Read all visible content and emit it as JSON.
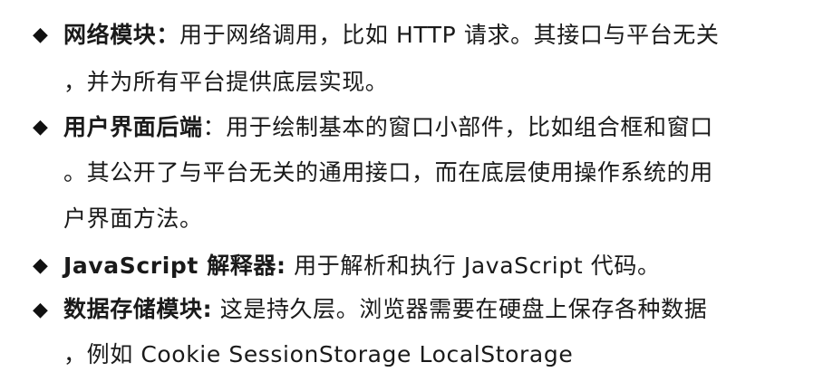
{
  "bullet_glyph": "◆",
  "items": [
    {
      "term": "网络模块：",
      "line1_rest": "用于网络调用，比如 HTTP 请求。其接口与平台无关",
      "line2": "，并为所有平台提供底层实现。"
    },
    {
      "term": "用户界面后端",
      "line1_rest": "：用于绘制基本的窗口小部件，比如组合框和窗口",
      "line2": "。其公开了与平台无关的通用接口，而在底层使用操作系统的用",
      "line3": "户界面方法。"
    },
    {
      "term": "JavaScript 解释器:",
      "line1_rest": " 用于解析和执行 JavaScript 代码。"
    },
    {
      "term": "数据存储模块:",
      "line1_rest": " 这是持久层。浏览器需要在硬盘上保存各种数据",
      "line2": "，例如 Cookie  SessionStorage   LocalStorage"
    }
  ]
}
